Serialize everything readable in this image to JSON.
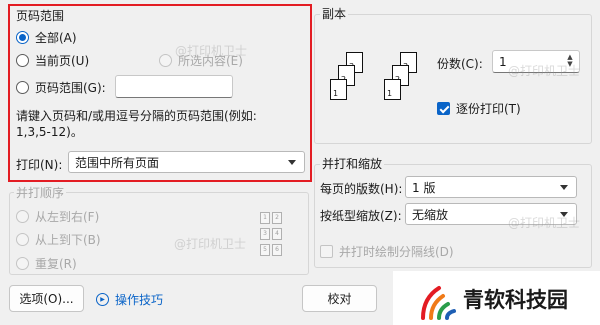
{
  "page_range": {
    "title": "页码范围",
    "all_label": "全部(A)",
    "current_label": "当前页(U)",
    "selection_label": "所选内容(E)",
    "range_label": "页码范围(G):",
    "range_value": "",
    "hint_line1": "请键入页码和/或用逗号分隔的页码范围(例如:",
    "hint_line2": "1,3,5-12)。",
    "print_label": "打印(N):",
    "print_value": "范围中所有页面"
  },
  "copies": {
    "title": "副本",
    "count_label": "份数(C):",
    "count_value": "1",
    "collate_label": "逐份打印(T)",
    "page_numbers": [
      "1",
      "2",
      "3"
    ]
  },
  "order": {
    "title": "并打顺序",
    "ltr_label": "从左到右(F)",
    "ttb_label": "从上到下(B)",
    "repeat_label": "重复(R)",
    "grid_numbers": [
      "1",
      "2",
      "3",
      "4",
      "5",
      "6"
    ]
  },
  "scaling": {
    "title": "并打和缩放",
    "per_sheet_label": "每页的版数(H):",
    "per_sheet_value": "1 版",
    "scale_label": "按纸型缩放(Z):",
    "scale_value": "无缩放",
    "divider_label": "并打时绘制分隔线(D)"
  },
  "footer": {
    "options_label": "选项(O)...",
    "tips_label": "操作技巧",
    "proofread_label": "校对"
  },
  "watermarks": {
    "text": "@打印机卫士",
    "logo_text": "青软科技园"
  },
  "colors": {
    "highlight": "#e31c23",
    "accent": "#0a64c8"
  }
}
